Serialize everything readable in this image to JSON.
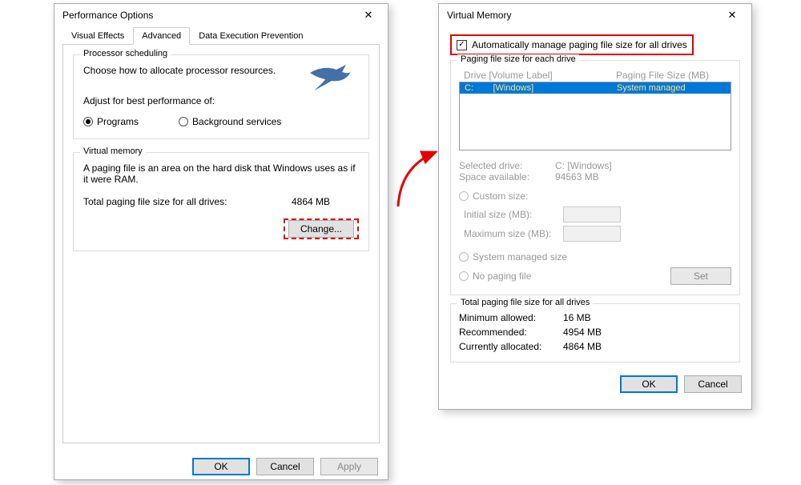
{
  "perf": {
    "title": "Performance Options",
    "tabs": {
      "visual": "Visual Effects",
      "advanced": "Advanced",
      "dep": "Data Execution Prevention"
    },
    "processor": {
      "group": "Processor scheduling",
      "desc": "Choose how to allocate processor resources.",
      "adjust": "Adjust for best performance of:",
      "programs": "Programs",
      "background": "Background services"
    },
    "vm": {
      "group": "Virtual memory",
      "desc": "A paging file is an area on the hard disk that Windows uses as if it were RAM.",
      "total_label": "Total paging file size for all drives:",
      "total_value": "4864 MB",
      "change": "Change..."
    },
    "buttons": {
      "ok": "OK",
      "cancel": "Cancel",
      "apply": "Apply"
    }
  },
  "vmd": {
    "title": "Virtual Memory",
    "auto_label": "Automatically manage paging file size for all drives",
    "paging_group": "Paging file size for each drive",
    "header_drive": "Drive  [Volume Label]",
    "header_size": "Paging File Size (MB)",
    "row_drive": "C:        [Windows]",
    "row_size": "System managed",
    "selected_drive_label": "Selected drive:",
    "selected_drive_value": "C:  [Windows]",
    "space_label": "Space available:",
    "space_value": "94563 MB",
    "custom": "Custom size:",
    "initial": "Initial size (MB):",
    "maximum": "Maximum size (MB):",
    "system_managed": "System managed size",
    "no_paging": "No paging file",
    "set": "Set",
    "total_group": "Total paging file size for all drives",
    "min_label": "Minimum allowed:",
    "min_value": "16 MB",
    "rec_label": "Recommended:",
    "rec_value": "4954 MB",
    "cur_label": "Currently allocated:",
    "cur_value": "4864 MB",
    "ok": "OK",
    "cancel": "Cancel"
  }
}
